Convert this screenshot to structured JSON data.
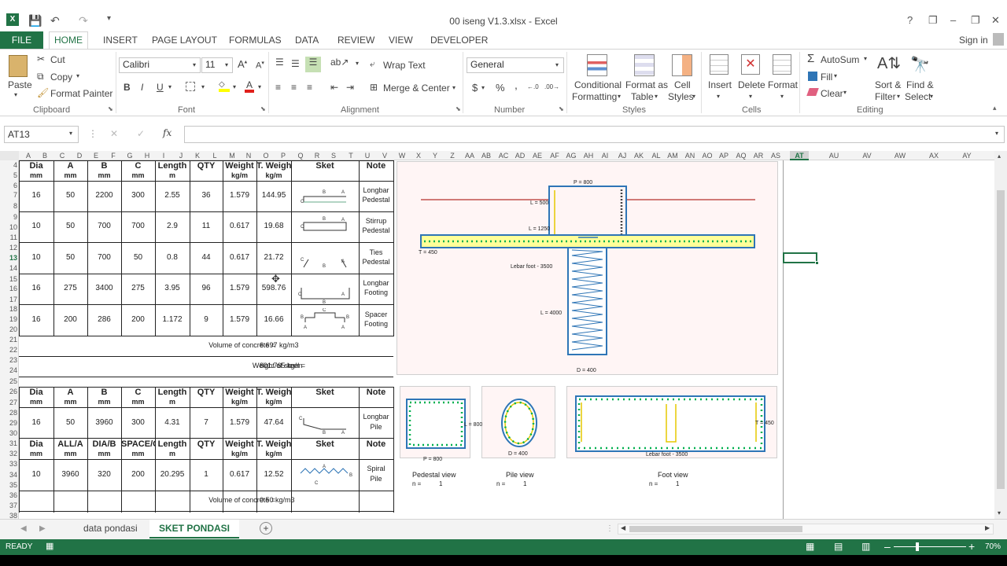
{
  "window": {
    "title": "00 iseng V1.3.xlsx - Excel",
    "help": "?",
    "restore": "❐",
    "minimize": "–",
    "maximize": "❐",
    "close": "✕"
  },
  "tabs": [
    "FILE",
    "HOME",
    "INSERT",
    "PAGE LAYOUT",
    "FORMULAS",
    "DATA",
    "REVIEW",
    "VIEW",
    "DEVELOPER"
  ],
  "signin": "Sign in",
  "ribbon": {
    "clipboard": {
      "paste": "Paste",
      "cut": "Cut",
      "copy": "Copy",
      "format_painter": "Format Painter",
      "label": "Clipboard"
    },
    "font": {
      "name": "Calibri",
      "size": "11",
      "bold": "B",
      "italic": "I",
      "underline": "U",
      "label": "Font"
    },
    "alignment": {
      "wrap": "Wrap Text",
      "merge": "Merge & Center",
      "label": "Alignment"
    },
    "number": {
      "format": "General",
      "currency": "$",
      "percent": "%",
      "comma": ",",
      "label": "Number"
    },
    "styles": {
      "cond": "Conditional",
      "cond2": "Formatting",
      "fmt_table": "Format as",
      "fmt_table2": "Table",
      "cell_styles": "Cell",
      "cell_styles2": "Styles",
      "label": "Styles"
    },
    "cells": {
      "insert": "Insert",
      "delete": "Delete",
      "format": "Format",
      "label": "Cells"
    },
    "editing": {
      "autosum": "AutoSum",
      "fill": "Fill",
      "clear": "Clear",
      "sort": "Sort &",
      "sort2": "Filter",
      "find": "Find &",
      "find2": "Select",
      "label": "Editing"
    }
  },
  "formula_bar": {
    "name_box": "AT13",
    "fx": "fx",
    "cancel": "✕",
    "enter": "✓",
    "value": ""
  },
  "columns": [
    "A",
    "B",
    "C",
    "D",
    "E",
    "F",
    "G",
    "H",
    "I",
    "J",
    "K",
    "L",
    "M",
    "N",
    "O",
    "P",
    "Q",
    "R",
    "S",
    "T",
    "U",
    "V",
    "W",
    "X",
    "Y",
    "Z",
    "AA",
    "AB",
    "AC",
    "AD",
    "AE",
    "AF",
    "AG",
    "AH",
    "AI",
    "AJ",
    "AK",
    "AL",
    "AM",
    "AN",
    "AO",
    "AP",
    "AQ",
    "AR",
    "AS",
    "AT",
    "AU",
    "AV",
    "AW",
    "AX",
    "AY"
  ],
  "rows": [
    "4",
    "5",
    "6",
    "7",
    "8",
    "9",
    "10",
    "11",
    "12",
    "13",
    "14",
    "15",
    "16",
    "17",
    "18",
    "19",
    "20",
    "21",
    "22",
    "23",
    "24",
    "25",
    "26",
    "27",
    "28",
    "29",
    "30",
    "31",
    "32",
    "33",
    "34",
    "35",
    "36",
    "37",
    "38"
  ],
  "table1": {
    "headers": [
      "Dia",
      "A",
      "B",
      "C",
      "Length",
      "QTY",
      "Weight",
      "T. Weigh",
      "Sket",
      "Note"
    ],
    "units": [
      "mm",
      "mm",
      "mm",
      "mm",
      "m",
      "",
      "kg/m",
      "kg/m",
      "",
      ""
    ],
    "rows": [
      [
        "16",
        "50",
        "2200",
        "300",
        "2.55",
        "36",
        "1.579",
        "144.95",
        "Longbar",
        "Pedestal"
      ],
      [
        "10",
        "50",
        "700",
        "700",
        "2.9",
        "11",
        "0.617",
        "19.68",
        "Stirrup",
        "Pedestal"
      ],
      [
        "10",
        "50",
        "700",
        "50",
        "0.8",
        "44",
        "0.617",
        "21.72",
        "Ties",
        "Pedestal"
      ],
      [
        "16",
        "275",
        "3400",
        "275",
        "3.95",
        "96",
        "1.579",
        "598.76",
        "Longbar",
        "Footing"
      ],
      [
        "16",
        "200",
        "286",
        "200",
        "1.172",
        "9",
        "1.579",
        "16.66",
        "Spacer",
        "Footing"
      ]
    ],
    "vol_label": "Volume of concrete =",
    "vol_value": "6.697 kg/m3",
    "steel_label": "Weight of steel =",
    "steel_value": "801.765 kg/m"
  },
  "table2": {
    "headers": [
      "Dia",
      "A",
      "B",
      "C",
      "Length",
      "QTY",
      "Weight",
      "T. Weigh",
      "Sket",
      "Note"
    ],
    "units": [
      "mm",
      "mm",
      "mm",
      "mm",
      "m",
      "",
      "kg/m",
      "kg/m",
      "",
      ""
    ],
    "row": [
      "16",
      "50",
      "3960",
      "300",
      "4.31",
      "7",
      "1.579",
      "47.64",
      "Longbar",
      "Pile"
    ],
    "headers2": [
      "Dia",
      "ALL/A",
      "DIA/B",
      "SPACE/C",
      "Length",
      "QTY",
      "Weight",
      "T. Weigh",
      "Sket",
      "Note"
    ],
    "row2": [
      "10",
      "3960",
      "320",
      "200",
      "20.295",
      "1",
      "0.617",
      "12.52",
      "Spiral",
      "Pile"
    ],
    "vol_label": "Volume of concrete =",
    "vol_value": "0.50 kg/m3"
  },
  "drawing": {
    "p": "P = 800",
    "l500": "L = 500",
    "l1250": "L = 1250",
    "t450": "T = 450",
    "lebar": "Lebar foot - 3500",
    "l4000": "L = 4000",
    "d400": "D = 400"
  },
  "views": {
    "ped_dim": "L = 800",
    "ped_p": "P = 800",
    "pile_d": "D = 400",
    "foot_t": "T = 450",
    "foot_lebar": "Lebar foot - 3500",
    "ped_label": "Pedestal view",
    "pile_label": "Pile view",
    "foot_label": "Foot view",
    "n": "n =",
    "n_val": "1"
  },
  "sheets": [
    "data pondasi",
    "SKET PONDASI"
  ],
  "status": {
    "ready": "READY",
    "zoom": "70%"
  }
}
